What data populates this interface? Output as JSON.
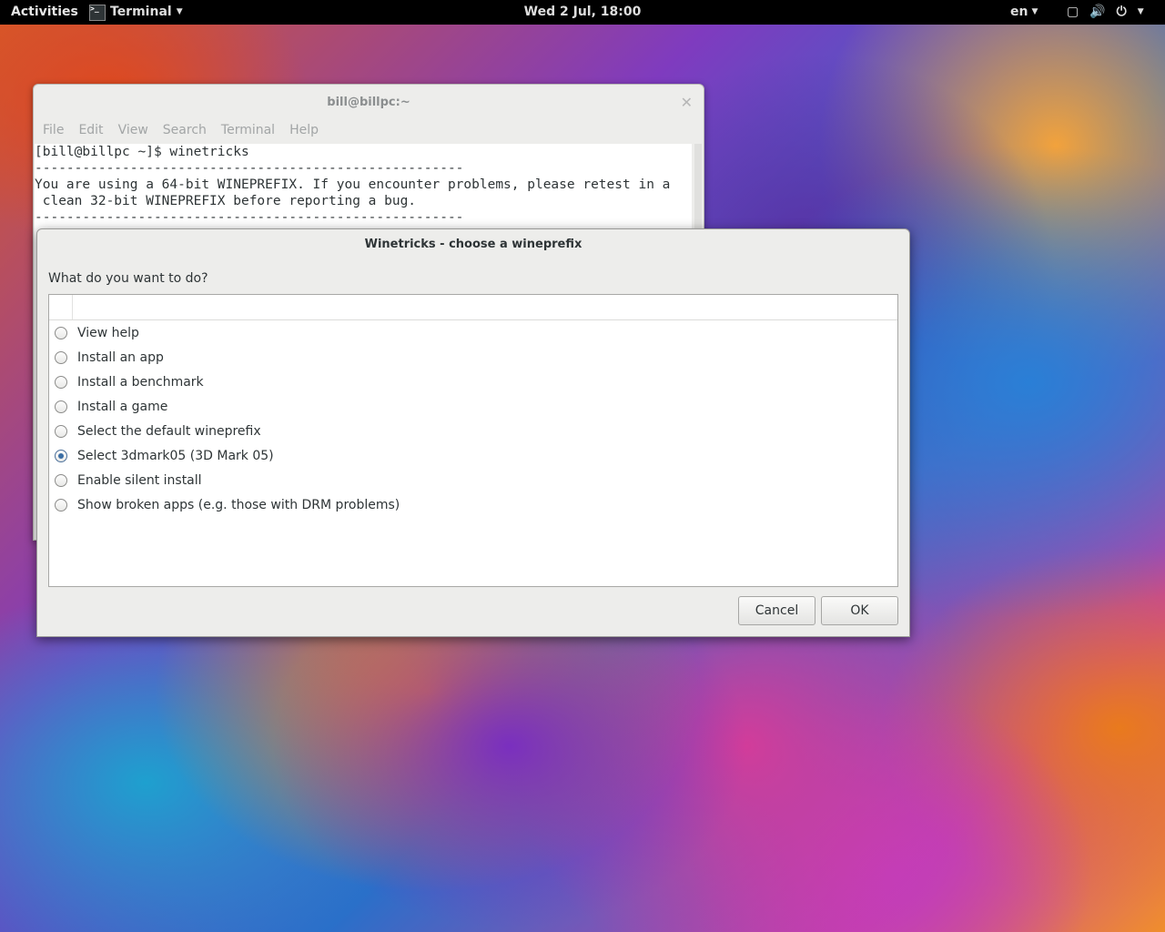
{
  "topbar": {
    "activities": "Activities",
    "app_menu": "Terminal",
    "clock": "Wed  2 Jul, 18:00",
    "language": "en"
  },
  "terminal": {
    "title": "bill@billpc:~",
    "menu": [
      "File",
      "Edit",
      "View",
      "Search",
      "Terminal",
      "Help"
    ],
    "lines": [
      "[bill@billpc ~]$ winetricks",
      "------------------------------------------------------",
      "You are using a 64-bit WINEPREFIX. If you encounter problems, please retest in a",
      " clean 32-bit WINEPREFIX before reporting a bug.",
      "------------------------------------------------------"
    ]
  },
  "dialog": {
    "title": "Winetricks - choose a wineprefix",
    "prompt": "What do you want to do?",
    "options": [
      {
        "label": "View help",
        "selected": false
      },
      {
        "label": "Install an app",
        "selected": false
      },
      {
        "label": "Install a benchmark",
        "selected": false
      },
      {
        "label": "Install a game",
        "selected": false
      },
      {
        "label": "Select the default wineprefix",
        "selected": false
      },
      {
        "label": "Select 3dmark05 (3D Mark 05)",
        "selected": true
      },
      {
        "label": "Enable silent install",
        "selected": false
      },
      {
        "label": "Show broken apps (e.g. those with DRM problems)",
        "selected": false
      }
    ],
    "cancel_label": "Cancel",
    "ok_label": "OK"
  },
  "icons": {
    "app_menu_icon": "terminal-icon",
    "tray": [
      "screen-icon",
      "volume-icon",
      "power-icon"
    ]
  }
}
